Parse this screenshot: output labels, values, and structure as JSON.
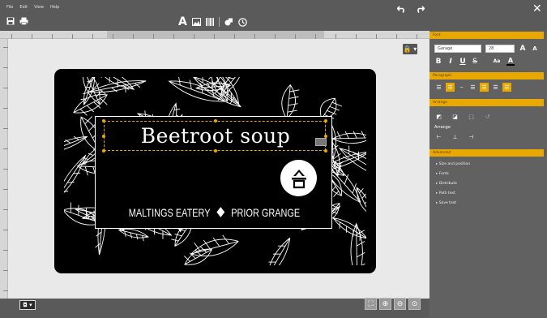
{
  "menu": {
    "items": [
      "File",
      "Edit",
      "View",
      "Help"
    ]
  },
  "toolbar": {
    "file_icons": [
      "save-icon",
      "print-icon"
    ],
    "insert_icons": [
      "text-icon",
      "image-icon",
      "barcode-icon",
      "shape-icon",
      "clipart-icon"
    ],
    "history_icons": [
      "undo-icon",
      "redo-icon"
    ],
    "close_glyph": "✕"
  },
  "card": {
    "title": "Beetroot soup",
    "footer_left": "MALTINGS EATERY",
    "footer_right": "PRIOR GRANGE",
    "background_color": "#000000",
    "accent": "#e8a800"
  },
  "canvas": {
    "lock_label": "🔒 ▾",
    "page_label": "◘ ▾"
  },
  "zoom": {
    "buttons": [
      "fit-icon",
      "zoom-in-icon",
      "zoom-out-icon",
      "zoom-reset-icon"
    ]
  },
  "sidebar": {
    "font": {
      "header": "Font",
      "family": "Garage",
      "size": "28",
      "grow": "A",
      "shrink": "A"
    },
    "format_buttons": [
      "B",
      "I",
      "U",
      "S",
      "Aa",
      "A"
    ],
    "paragraph": {
      "header": "Paragraph",
      "alignment_active": [
        1,
        4,
        5
      ]
    },
    "arrange": {
      "header": "Arrange",
      "sub_label": "Arrange"
    },
    "advanced": {
      "header": "Advanced",
      "items": [
        "Size and position",
        "Fonts",
        "Distribute",
        "Path text",
        "Save text"
      ]
    }
  }
}
